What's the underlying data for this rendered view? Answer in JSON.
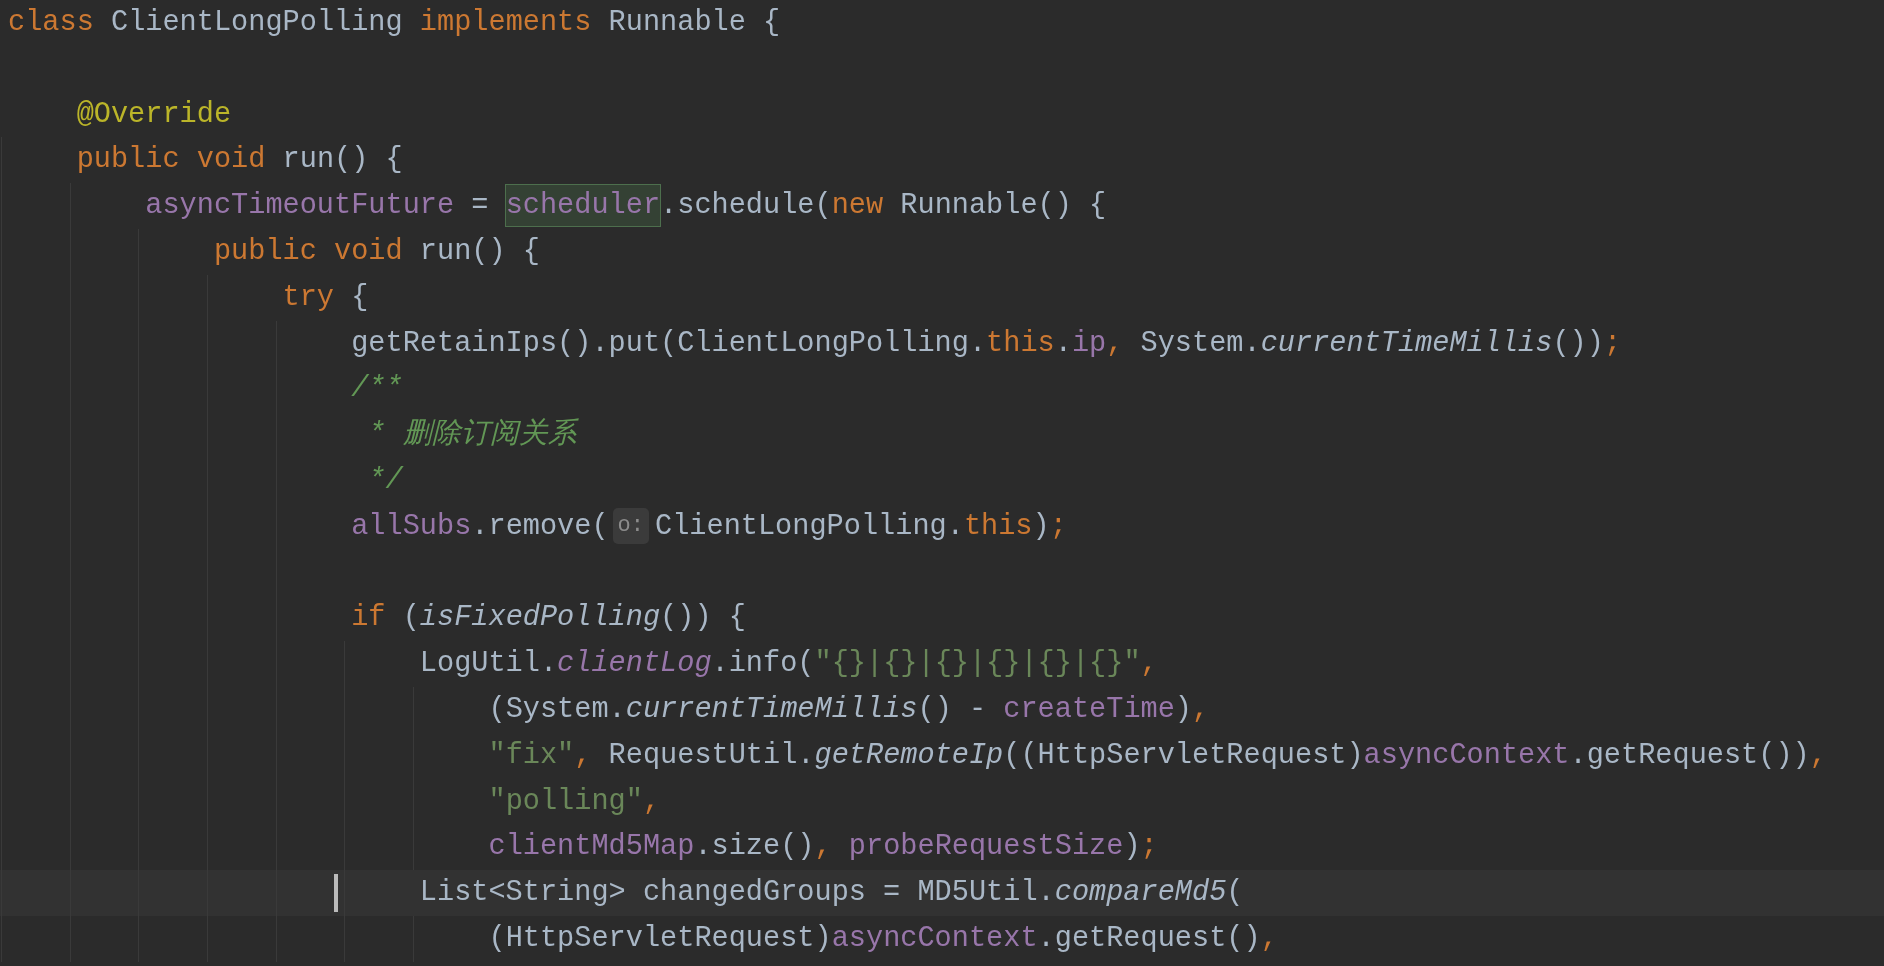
{
  "editor": {
    "lines": [
      {
        "tokens": [
          {
            "kind": "kw",
            "t": "class "
          },
          {
            "kind": "plain",
            "t": "ClientLongPolling "
          },
          {
            "kind": "kw",
            "t": "implements "
          },
          {
            "kind": "plain",
            "t": "Runnable {"
          }
        ]
      },
      {
        "blank_before": true,
        "tokens": [
          {
            "kind": "ann",
            "t": "    @Override"
          }
        ]
      },
      {
        "tokens": [
          {
            "kind": "kw",
            "t": "    public void "
          },
          {
            "kind": "plain",
            "t": "run() {"
          }
        ]
      },
      {
        "tokens": [
          {
            "kind": "field",
            "t": "        asyncTimeoutFuture"
          },
          {
            "kind": "plain",
            "t": " = "
          },
          {
            "kind": "match",
            "t": "scheduler"
          },
          {
            "kind": "plain",
            "t": ".schedule("
          },
          {
            "kind": "kw",
            "t": "new "
          },
          {
            "kind": "plain",
            "t": "Runnable() {"
          }
        ]
      },
      {
        "tokens": [
          {
            "kind": "kw",
            "t": "            public void "
          },
          {
            "kind": "plain",
            "t": "run() {"
          }
        ]
      },
      {
        "tokens": [
          {
            "kind": "kw",
            "t": "                try "
          },
          {
            "kind": "plain",
            "t": "{"
          }
        ]
      },
      {
        "tokens": [
          {
            "kind": "plain",
            "t": "                    getRetainIps().put(ClientLongPolling."
          },
          {
            "kind": "kw",
            "t": "this"
          },
          {
            "kind": "plain",
            "t": "."
          },
          {
            "kind": "field",
            "t": "ip"
          },
          {
            "kind": "kw",
            "t": ", "
          },
          {
            "kind": "plain",
            "t": "System."
          },
          {
            "kind": "smethod",
            "t": "currentTimeMillis"
          },
          {
            "kind": "plain",
            "t": "())"
          },
          {
            "kind": "kw",
            "t": ";"
          }
        ]
      },
      {
        "tokens": [
          {
            "kind": "doc",
            "t": "                    /**"
          }
        ]
      },
      {
        "tokens": [
          {
            "kind": "doc",
            "t": "                     * 删除订阅关系"
          }
        ]
      },
      {
        "tokens": [
          {
            "kind": "doc",
            "t": "                     */"
          }
        ]
      },
      {
        "tokens": [
          {
            "kind": "field",
            "t": "                    allSubs"
          },
          {
            "kind": "plain",
            "t": ".remove("
          },
          {
            "kind": "hint",
            "t": "o:"
          },
          {
            "kind": "plain",
            "t": "ClientLongPolling."
          },
          {
            "kind": "kw",
            "t": "this"
          },
          {
            "kind": "plain",
            "t": ")"
          },
          {
            "kind": "kw",
            "t": ";"
          }
        ]
      },
      {
        "blank_before": true,
        "tokens": [
          {
            "kind": "kw",
            "t": "                    if "
          },
          {
            "kind": "plain",
            "t": "("
          },
          {
            "kind": "smethod",
            "t": "isFixedPolling"
          },
          {
            "kind": "plain",
            "t": "()) {"
          }
        ]
      },
      {
        "tokens": [
          {
            "kind": "plain",
            "t": "                        LogUtil."
          },
          {
            "kind": "sfield",
            "t": "clientLog"
          },
          {
            "kind": "plain",
            "t": ".info("
          },
          {
            "kind": "str",
            "t": "\"{}|{}|{}|{}|{}|{}\""
          },
          {
            "kind": "kw",
            "t": ","
          }
        ]
      },
      {
        "tokens": [
          {
            "kind": "plain",
            "t": "                            (System."
          },
          {
            "kind": "smethod",
            "t": "currentTimeMillis"
          },
          {
            "kind": "plain",
            "t": "() - "
          },
          {
            "kind": "field",
            "t": "createTime"
          },
          {
            "kind": "plain",
            "t": ")"
          },
          {
            "kind": "kw",
            "t": ","
          }
        ]
      },
      {
        "tokens": [
          {
            "kind": "str",
            "t": "                            \"fix\""
          },
          {
            "kind": "kw",
            "t": ", "
          },
          {
            "kind": "plain",
            "t": "RequestUtil."
          },
          {
            "kind": "smethod",
            "t": "getRemoteIp"
          },
          {
            "kind": "plain",
            "t": "((HttpServletRequest)"
          },
          {
            "kind": "field",
            "t": "asyncContext"
          },
          {
            "kind": "plain",
            "t": ".getRequest())"
          },
          {
            "kind": "kw",
            "t": ","
          }
        ]
      },
      {
        "tokens": [
          {
            "kind": "str",
            "t": "                            \"polling\""
          },
          {
            "kind": "kw",
            "t": ","
          }
        ]
      },
      {
        "tokens": [
          {
            "kind": "field",
            "t": "                            clientMd5Map"
          },
          {
            "kind": "plain",
            "t": ".size()"
          },
          {
            "kind": "kw",
            "t": ", "
          },
          {
            "kind": "field",
            "t": "probeRequestSize"
          },
          {
            "kind": "plain",
            "t": ")"
          },
          {
            "kind": "kw",
            "t": ";"
          }
        ]
      },
      {
        "tokens": [
          {
            "kind": "caret"
          },
          {
            "kind": "plain",
            "t": "                        List<String> changedGroups = MD5Util."
          },
          {
            "kind": "smethod",
            "t": "compareMd5"
          },
          {
            "kind": "plain",
            "t": "("
          }
        ]
      },
      {
        "tokens": [
          {
            "kind": "plain",
            "t": "                            (HttpServletRequest)"
          },
          {
            "kind": "field",
            "t": "asyncContext"
          },
          {
            "kind": "plain",
            "t": ".getRequest()"
          },
          {
            "kind": "kw",
            "t": ","
          }
        ]
      }
    ]
  }
}
